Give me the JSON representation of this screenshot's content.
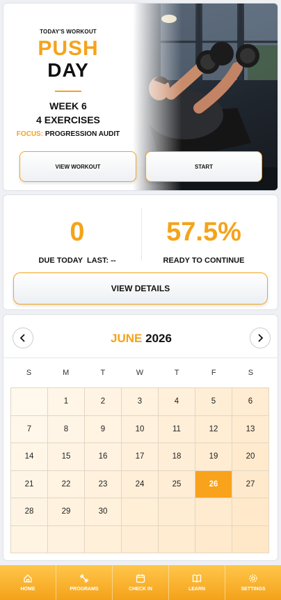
{
  "hero": {
    "kicker": "TODAY'S WORKOUT",
    "title_line1": "PUSH",
    "title_line2": "DAY",
    "week": "WEEK 6",
    "exercises": "4 EXERCISES",
    "focus_label": "FOCUS:",
    "focus_value": "PROGRESSION AUDIT",
    "view_button": "VIEW WORKOUT",
    "start_button": "START"
  },
  "stats": {
    "due_value": "0",
    "due_label": "DUE TODAY  LAST: --",
    "ready_value": "57.5%",
    "ready_label": "READY TO CONTINUE",
    "details_button": "VIEW DETAILS"
  },
  "calendar": {
    "month": "JUNE",
    "year": "2026",
    "weekdays": [
      "S",
      "M",
      "T",
      "W",
      "T",
      "F",
      "S"
    ],
    "today": 26,
    "first_weekday_offset": 1,
    "days_in_month": 30
  },
  "nav": {
    "items": [
      {
        "label": "HOME",
        "icon": "home-icon"
      },
      {
        "label": "PROGRAMS",
        "icon": "dumbbell-icon"
      },
      {
        "label": "CHECK IN",
        "icon": "calendar-icon"
      },
      {
        "label": "LEARN",
        "icon": "book-icon"
      },
      {
        "label": "SETTINGS",
        "icon": "gear-icon"
      }
    ]
  },
  "colors": {
    "accent": "#f5a31a",
    "today_fill": "#f9a21b"
  }
}
